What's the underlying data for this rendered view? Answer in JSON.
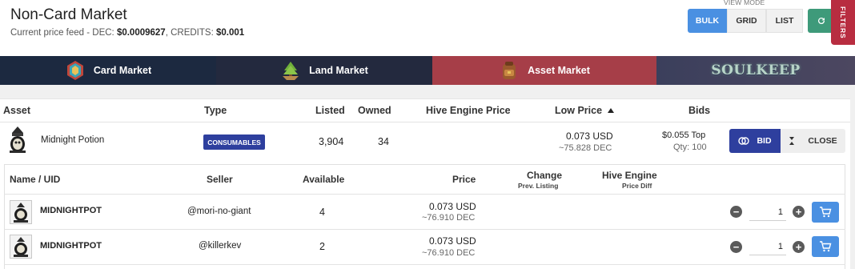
{
  "header": {
    "title": "Non-Card Market",
    "price_feed_prefix": "Current price feed - DEC: ",
    "dec_price": "$0.0009627",
    "credits_prefix": ", CREDITS: ",
    "credits_price": "$0.001",
    "view_mode_label": "VIEW MODE",
    "view_modes": [
      "BULK",
      "GRID",
      "LIST"
    ],
    "active_view_mode": "BULK",
    "filters_label": "FILTERS"
  },
  "nav": {
    "items": [
      {
        "label": "Card Market",
        "icon": "crystal-card-icon"
      },
      {
        "label": "Land Market",
        "icon": "land-tree-icon"
      },
      {
        "label": "Asset Market",
        "icon": "backpack-icon",
        "active": true
      },
      {
        "label": "SOULKEEP",
        "icon": "soulkeep-logo"
      }
    ]
  },
  "table": {
    "headers": {
      "asset": "Asset",
      "type": "Type",
      "listed": "Listed",
      "owned": "Owned",
      "hive_engine_price": "Hive Engine Price",
      "low_price": "Low Price",
      "bids": "Bids"
    },
    "sort_column": "Low Price",
    "sort_direction": "ascending",
    "row": {
      "asset": "Midnight Potion",
      "type": "CONSUMABLES",
      "listed": "3,904",
      "owned": "34",
      "low_price_usd": "0.073 USD",
      "low_price_dec": "~75.828 DEC",
      "bid_top": "$0.055 Top",
      "bid_qty": "Qty: 100",
      "bid_button": "BID",
      "close_button": "CLOSE"
    }
  },
  "listings": {
    "headers": {
      "name_uid": "Name / UID",
      "seller": "Seller",
      "available": "Available",
      "price": "Price",
      "change": "Change",
      "change_sub": "Prev. Listing",
      "hive_engine": "Hive Engine",
      "hive_engine_sub": "Price Diff"
    },
    "rows": [
      {
        "uid": "MIDNIGHTPOT",
        "seller": "@mori-no-giant",
        "available": "4",
        "price_usd": "0.073 USD",
        "price_dec": "~76.910 DEC",
        "qty": "1"
      },
      {
        "uid": "MIDNIGHTPOT",
        "seller": "@killerkev",
        "available": "2",
        "price_usd": "0.073 USD",
        "price_dec": "~76.910 DEC",
        "qty": "1"
      }
    ]
  },
  "colors": {
    "nav_bg": "#1c2940",
    "active_tab": "#a63e48",
    "primary": "#2e3f9e",
    "accent_blue": "#4a90e2",
    "refresh_green": "#3e9a7a",
    "filters_red": "#b82d40"
  }
}
